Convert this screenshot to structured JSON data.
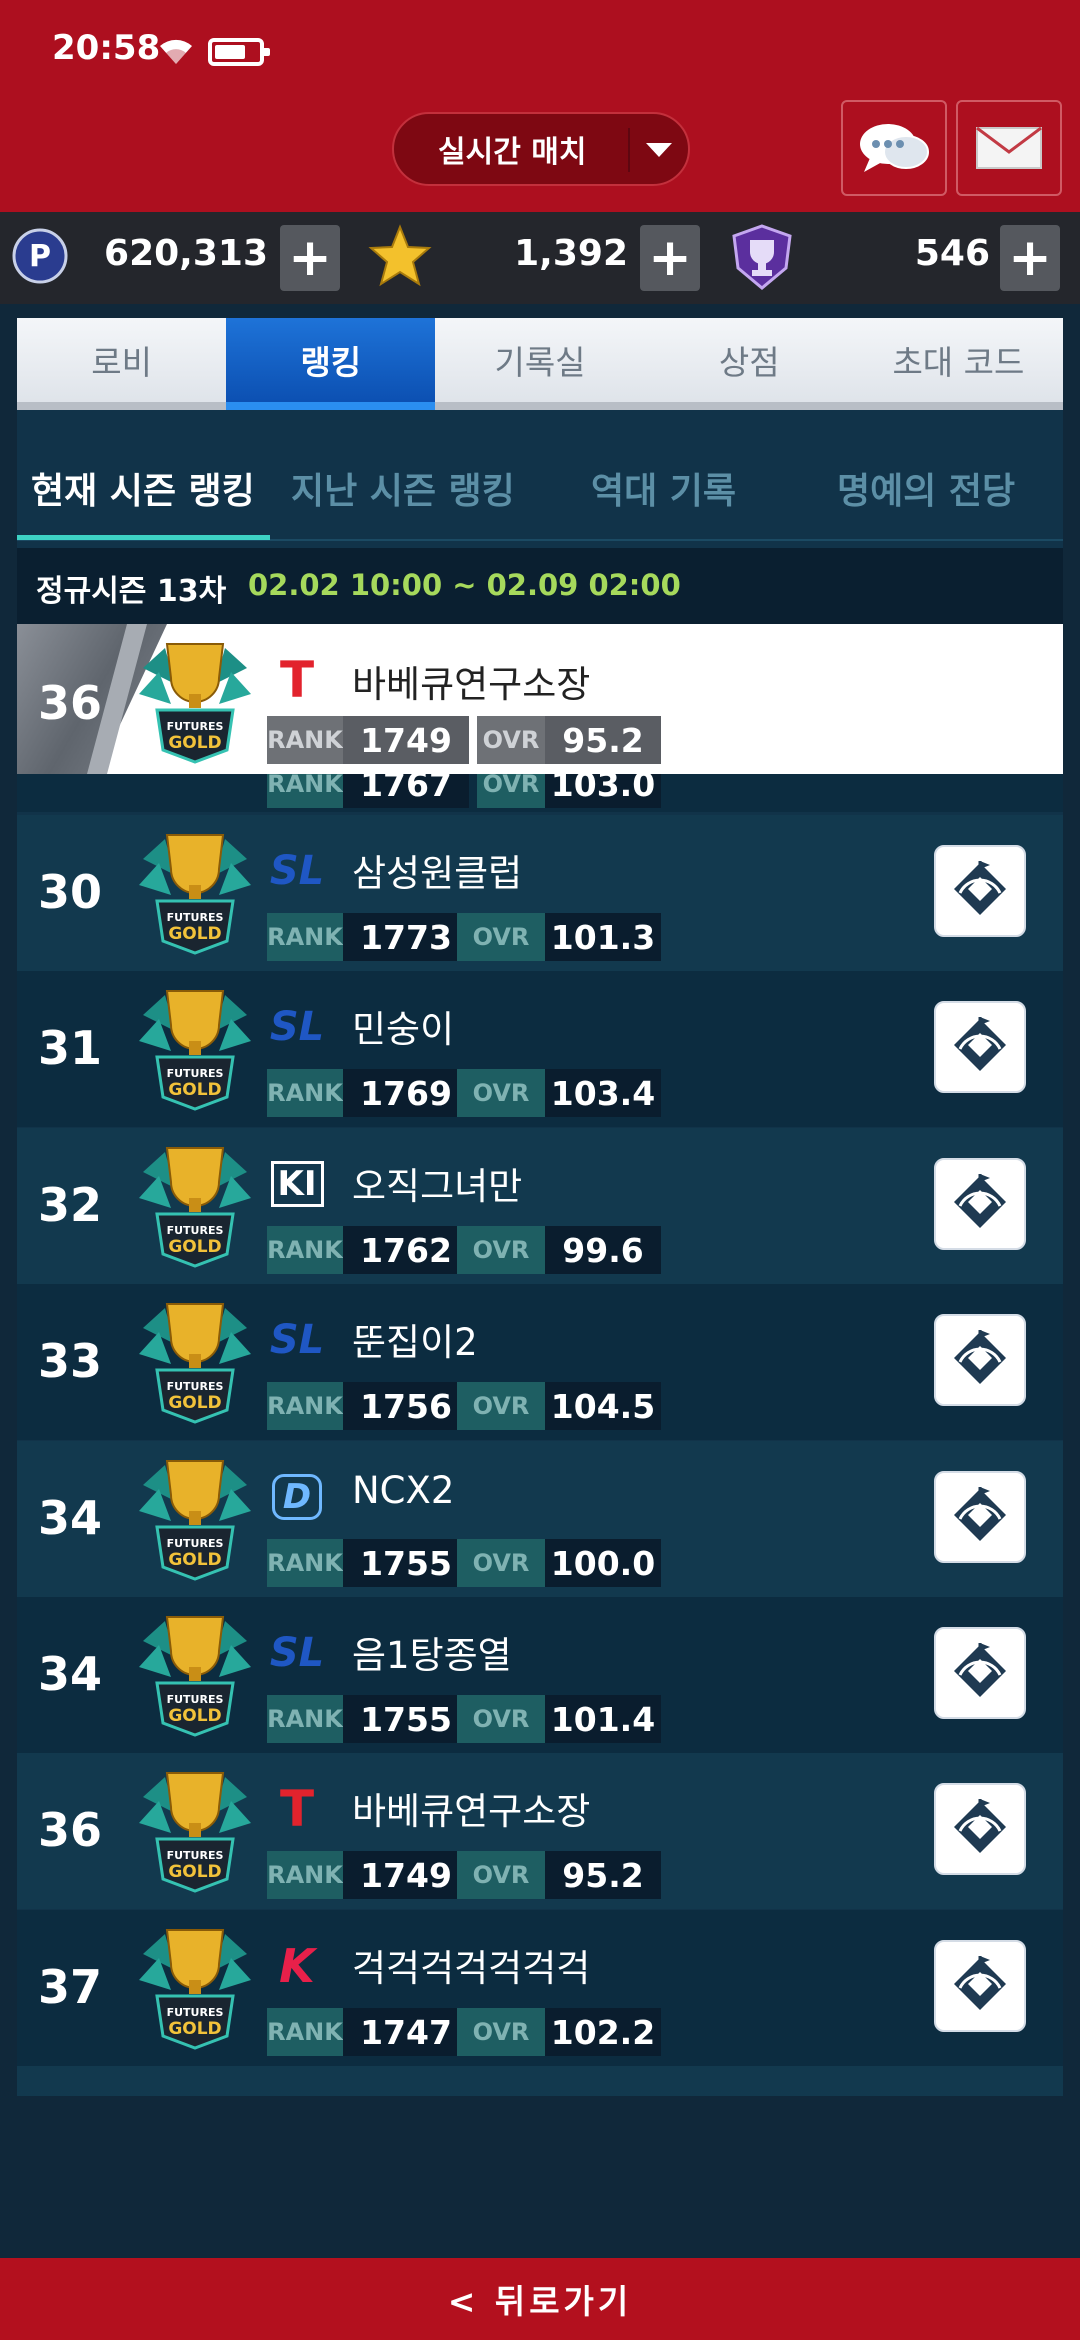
{
  "status_bar": {
    "time": "20:58"
  },
  "header": {
    "match_mode": "실시간 매치"
  },
  "currencies": [
    {
      "icon": "p-point-icon",
      "value": "620,313"
    },
    {
      "icon": "star-icon",
      "value": "1,392"
    },
    {
      "icon": "trophy-shield-icon",
      "value": "546"
    }
  ],
  "main_tabs": [
    "로비",
    "랭킹",
    "기록실",
    "상점",
    "초대 코드"
  ],
  "sub_tabs": [
    "현재 시즌 랭킹",
    "지난 시즌 랭킹",
    "역대 기록",
    "명예의 전당"
  ],
  "season": {
    "label": "정규시즌 13차",
    "dates": "02.02 10:00 ~ 02.09 02:00"
  },
  "labels": {
    "rank": "RANK",
    "ovr": "OVR",
    "tier": "FUTURES GOLD"
  },
  "my_entry": {
    "place": "36",
    "team": "T",
    "name": "바베큐연구소장",
    "rank": "1749",
    "ovr": "95.2"
  },
  "partial_row": {
    "rank": "1767",
    "ovr": "103.0"
  },
  "rankings": [
    {
      "place": "30",
      "team": "SL",
      "name": "삼성원클럽",
      "rank": "1773",
      "ovr": "101.3"
    },
    {
      "place": "31",
      "team": "SL",
      "name": "민숭이",
      "rank": "1769",
      "ovr": "103.4"
    },
    {
      "place": "32",
      "team": "KI",
      "name": "오직그녀만",
      "rank": "1762",
      "ovr": "99.6"
    },
    {
      "place": "33",
      "team": "SL",
      "name": "뚠집이2",
      "rank": "1756",
      "ovr": "104.5"
    },
    {
      "place": "34",
      "team": "D",
      "name": "NCX2",
      "rank": "1755",
      "ovr": "100.0"
    },
    {
      "place": "34",
      "team": "SL",
      "name": "음1탕종열",
      "rank": "1755",
      "ovr": "101.4"
    },
    {
      "place": "36",
      "team": "T",
      "name": "바베큐연구소장",
      "rank": "1749",
      "ovr": "95.2"
    },
    {
      "place": "37",
      "team": "K",
      "name": "걱걱걱걱걱걱걱",
      "rank": "1747",
      "ovr": "102.2"
    }
  ],
  "footer": {
    "back": "< 뒤로가기"
  }
}
